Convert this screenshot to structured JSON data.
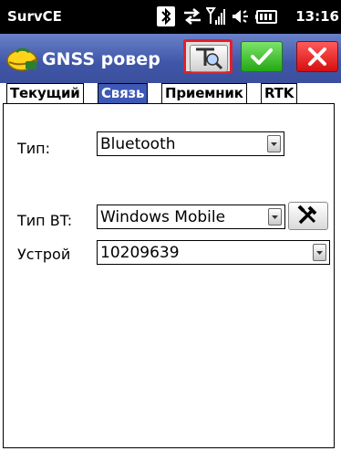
{
  "statusbar": {
    "app_name": "SurvCE",
    "time": "13:16",
    "icons": [
      "bluetooth-icon",
      "data-sync-icon",
      "signal-icon",
      "volume-icon",
      "battery-icon"
    ]
  },
  "titlebar": {
    "title": "GNSS ровер",
    "logo_icon": "helmet-logo-icon",
    "buttons": [
      "rover-config-icon",
      "ok-check-icon",
      "cancel-x-icon"
    ]
  },
  "tabs": [
    {
      "label": "Текущий",
      "active": false
    },
    {
      "label": "Связь",
      "active": true
    },
    {
      "label": "Приемник",
      "active": false
    },
    {
      "label": "RTK",
      "active": false
    }
  ],
  "form": {
    "type_label": "Тип:",
    "type_value": "Bluetooth",
    "bt_type_label": "Тип BT:",
    "bt_type_value": "Windows Mobile",
    "device_label": "Устрой",
    "device_value": "10209639"
  },
  "colors": {
    "title_bar": "#3f56a8",
    "active_tab": "#3d59b6",
    "ok_button": "#23a814",
    "cancel_button": "#d60f0f",
    "highlight_border": "#e0202a"
  }
}
